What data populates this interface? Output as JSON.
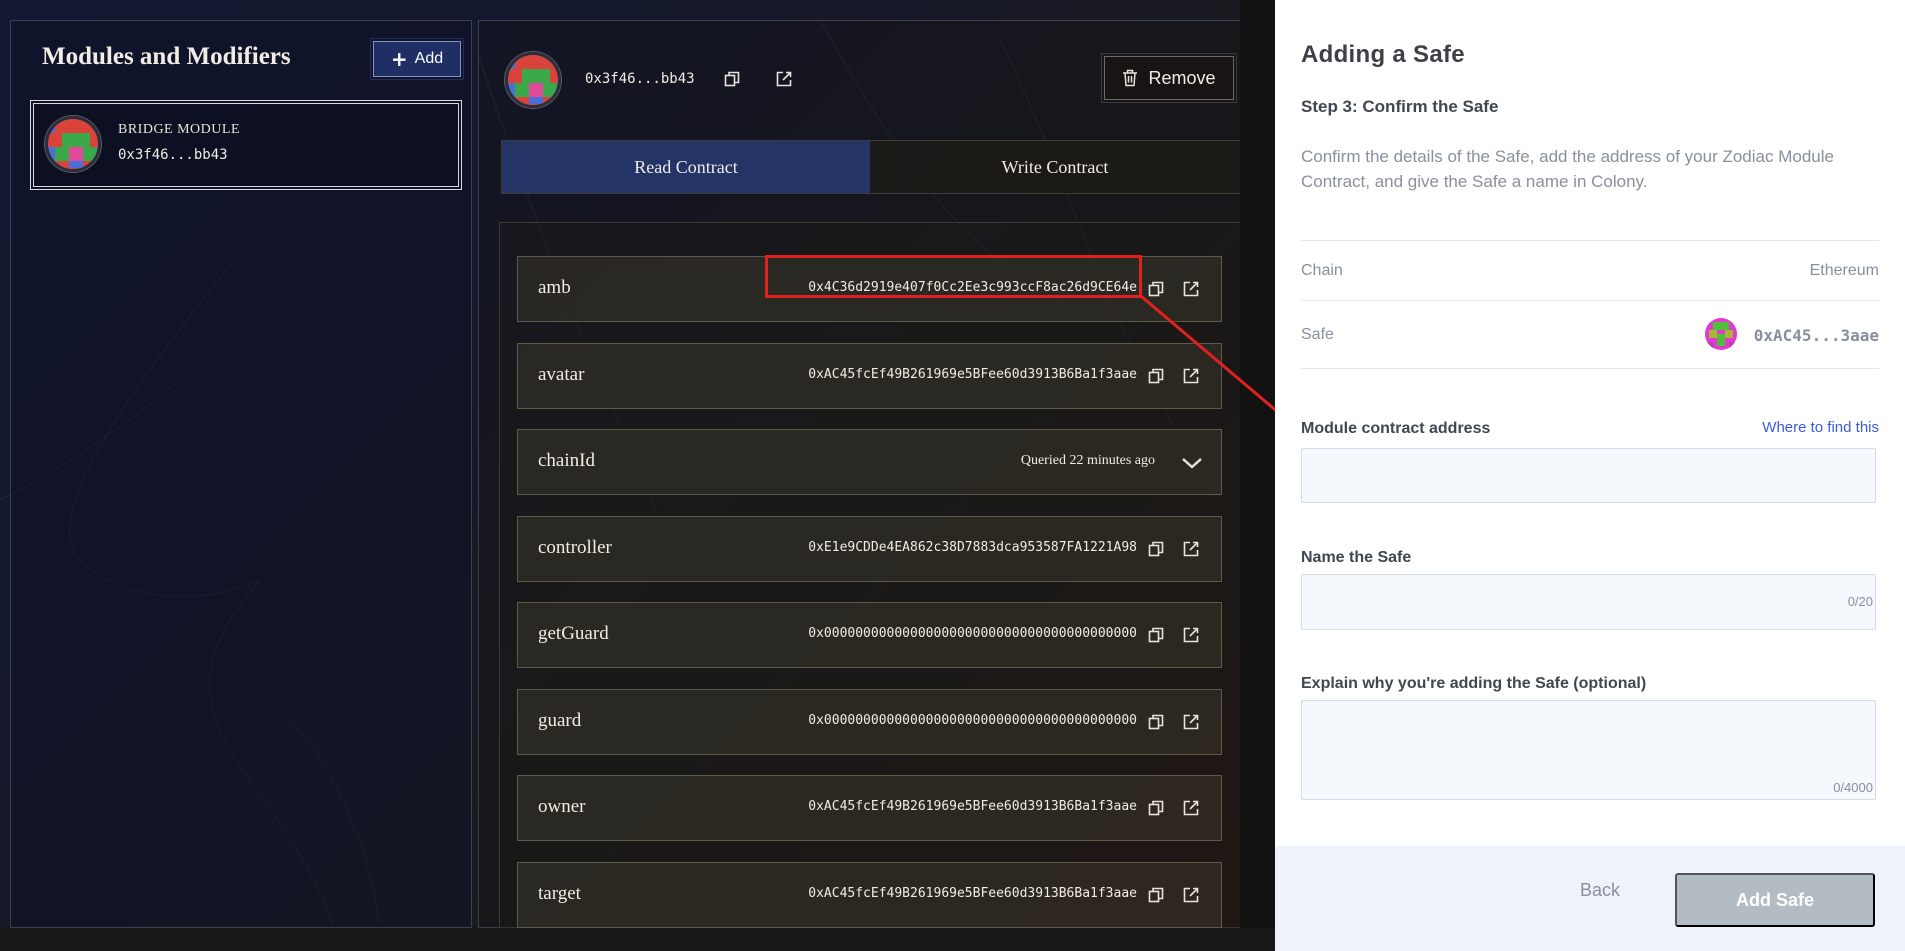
{
  "left_panel": {
    "title": "Modules and Modifiers",
    "add_label": "Add",
    "module": {
      "name": "BRIDGE MODULE",
      "address": "0x3f46...bb43"
    }
  },
  "right_panel": {
    "header_address": "0x3f46...bb43",
    "remove_label": "Remove",
    "tabs": {
      "read": "Read Contract",
      "write": "Write Contract"
    },
    "rows": [
      {
        "name": "amb",
        "value": "0x4C36d2919e407f0Cc2Ee3c993ccF8ac26d9CE64e"
      },
      {
        "name": "avatar",
        "value": "0xAC45fcEf49B261969e5BFee60d3913B6Ba1f3aae"
      },
      {
        "name": "chainId",
        "queried": "Queried 22 minutes ago"
      },
      {
        "name": "controller",
        "value": "0xE1e9CDDe4EA862c38D7883dca953587FA1221A98"
      },
      {
        "name": "getGuard",
        "value": "0x0000000000000000000000000000000000000000"
      },
      {
        "name": "guard",
        "value": "0x0000000000000000000000000000000000000000"
      },
      {
        "name": "owner",
        "value": "0xAC45fcEf49B261969e5BFee60d3913B6Ba1f3aae"
      },
      {
        "name": "target",
        "value": "0xAC45fcEf49B261969e5BFee60d3913B6Ba1f3aae"
      }
    ]
  },
  "modal": {
    "title": "Adding a Safe",
    "step": "Step 3: Confirm the Safe",
    "description": "Confirm the details of the Safe, add the address of your Zodiac Module Contract, and give the Safe a name in Colony.",
    "chain_label": "Chain",
    "chain_value": "Ethereum",
    "safe_label": "Safe",
    "safe_address": "0xAC45...3aae",
    "module_address_label": "Module contract address",
    "where_to_find": "Where to find this",
    "module_address_value": "",
    "name_label": "Name the Safe",
    "name_value": "",
    "name_counter": "0/20",
    "explain_label": "Explain why you're adding the Safe (optional)",
    "explain_value": "",
    "explain_counter": "0/4000",
    "back_label": "Back",
    "add_safe_label": "Add Safe"
  },
  "colors": {
    "read_tab": "#253467",
    "highlight": "#e2201f",
    "link": "#3b5bdb",
    "add_safe_disabled": "#b4bcc3"
  }
}
